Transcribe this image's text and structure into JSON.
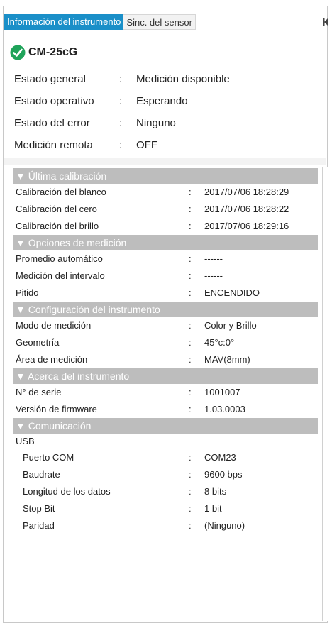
{
  "tabs": [
    {
      "label": "Información del instrumento",
      "active": true
    },
    {
      "label": "Sinc. del sensor",
      "active": false
    }
  ],
  "device": {
    "name": "CM-25cG",
    "status_icon": "check-circle-icon",
    "status_color": "#1fa35a"
  },
  "colors": {
    "accent": "#1a8fc8",
    "section_header": "#bdbdbd"
  },
  "separator": ":",
  "status": [
    {
      "label": "Estado general",
      "value": "Medición disponible"
    },
    {
      "label": "Estado operativo",
      "value": "Esperando"
    },
    {
      "label": "Estado del error",
      "value": "Ninguno"
    },
    {
      "label": "Medición remota",
      "value": "OFF"
    }
  ],
  "sections": [
    {
      "title": "▼ Última calibración",
      "rows": [
        {
          "label": "Calibración del blanco",
          "value": "2017/07/06 18:28:29"
        },
        {
          "label": "Calibración del cero",
          "value": "2017/07/06 18:28:22"
        },
        {
          "label": "Calibración del brillo",
          "value": "2017/07/06 18:29:16"
        }
      ]
    },
    {
      "title": "▼ Opciones de medición",
      "rows": [
        {
          "label": "Promedio automático",
          "value": "------"
        },
        {
          "label": "Medición del intervalo",
          "value": "------"
        },
        {
          "label": "Pitido",
          "value": "ENCENDIDO"
        }
      ]
    },
    {
      "title": "▼ Configuración del instrumento",
      "rows": [
        {
          "label": "Modo de medición",
          "value": "Color y Brillo"
        },
        {
          "label": "Geometría",
          "value": "45°c:0°"
        },
        {
          "label": "Área de medición",
          "value": "MAV(8mm)"
        }
      ]
    },
    {
      "title": "▼ Acerca del instrumento",
      "rows": [
        {
          "label": "N° de serie",
          "value": "1001007"
        },
        {
          "label": "Versión de firmware",
          "value": "1.03.0003"
        }
      ]
    },
    {
      "title": "▼ Comunicación",
      "group_label": "USB",
      "rows": [
        {
          "label": "Puerto COM",
          "value": "COM23"
        },
        {
          "label": "Baudrate",
          "value": "9600 bps"
        },
        {
          "label": "Longitud de los datos",
          "value": "8 bits"
        },
        {
          "label": "Stop Bit",
          "value": "1 bit"
        },
        {
          "label": "Paridad",
          "value": "(Ninguno)"
        }
      ]
    }
  ]
}
